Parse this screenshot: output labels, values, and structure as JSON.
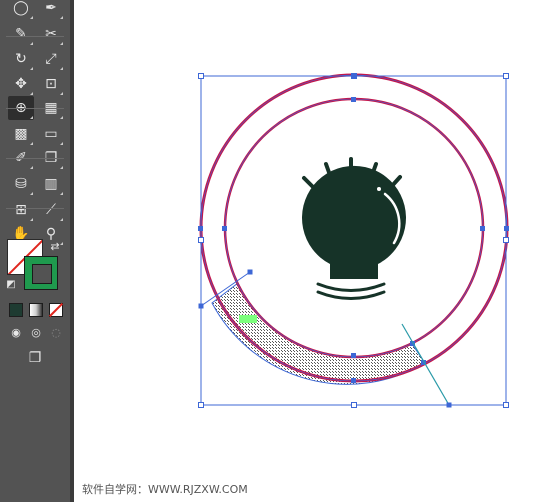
{
  "toolbar": {
    "tools": [
      {
        "name": "ellipse-tool",
        "glyph": "◯"
      },
      {
        "name": "paintbrush-tool",
        "glyph": "✒"
      },
      {
        "name": "pencil-tool",
        "glyph": "✎"
      },
      {
        "name": "scissors-tool",
        "glyph": "✂"
      },
      {
        "name": "rotate-tool",
        "glyph": "↻"
      },
      {
        "name": "scale-tool",
        "glyph": "⤢"
      },
      {
        "name": "puppet-warp-tool",
        "glyph": "✥"
      },
      {
        "name": "free-transform-tool",
        "glyph": "⊡"
      },
      {
        "name": "shape-builder-tool",
        "glyph": "⊕"
      },
      {
        "name": "perspective-grid-tool",
        "glyph": "▦"
      },
      {
        "name": "mesh-tool",
        "glyph": "▩"
      },
      {
        "name": "gradient-tool",
        "glyph": "▭"
      },
      {
        "name": "eyedropper-tool",
        "glyph": "✐"
      },
      {
        "name": "blend-tool",
        "glyph": "❐"
      },
      {
        "name": "symbol-sprayer-tool",
        "glyph": "⛁"
      },
      {
        "name": "column-graph-tool",
        "glyph": "▥"
      },
      {
        "name": "artboard-tool",
        "glyph": "⊞"
      },
      {
        "name": "slice-tool",
        "glyph": "⟋"
      },
      {
        "name": "hand-tool",
        "glyph": "✋"
      },
      {
        "name": "zoom-tool",
        "glyph": "⚲"
      }
    ],
    "fill_color": "#ffffff",
    "stroke_color": "#1f9a4e",
    "mode_colors": [
      "#1e3b31",
      "#cfcfcf",
      "#e0261f"
    ]
  },
  "canvas": {
    "accent_ring": "#c4164b",
    "selection": "#3d67d6",
    "bulb_fill": "#163328",
    "highlight": "#7dff7d"
  },
  "footer": {
    "text": "软件自学网：WWW.RJZXW.COM"
  }
}
